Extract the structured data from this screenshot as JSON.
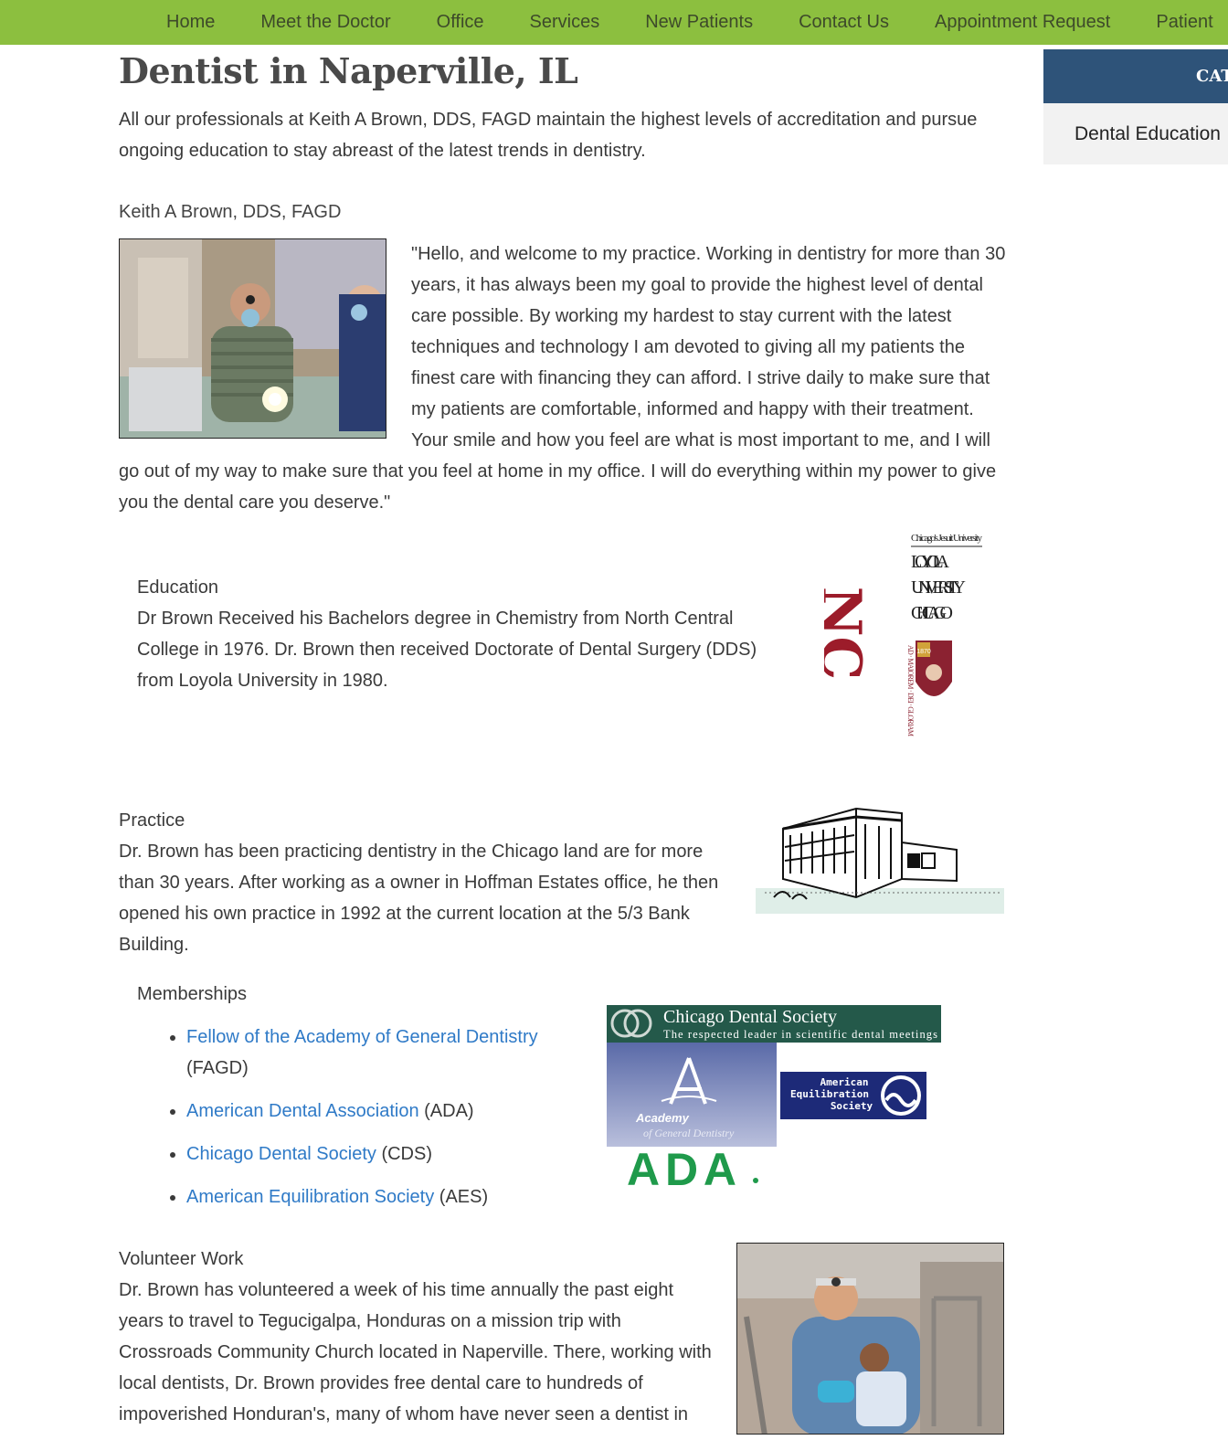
{
  "nav": {
    "items": [
      "Home",
      "Meet the Doctor",
      "Office",
      "Services",
      "New Patients",
      "Contact Us",
      "Appointment Request",
      "Patient"
    ]
  },
  "main": {
    "title": "Dentist in Naperville, IL",
    "intro": "All our professionals at Keith A Brown, DDS, FAGD maintain the highest levels of accreditation and pursue ongoing education to stay abreast of the latest trends in dentistry.",
    "doctor_name": "Keith A Brown, DDS, FAGD",
    "welcome": "\"Hello, and welcome to my practice. Working in dentistry for more than 30 years, it has always been my goal to provide the highest level of dental care possible. By working my hardest to stay current with the latest techniques and technology I am devoted to giving all my patients the finest care with financing they can afford. I strive daily to make sure that my patients are comfortable, informed and happy with their treatment. Your smile and how you feel are what is most important to me, and I will go out of my way to make sure that you feel at home in my office. I will do everything within my power to give you the dental care you deserve.\"",
    "education": {
      "heading": "Education",
      "text": "Dr Brown Received his Bachelors degree in Chemistry from North Central College in 1976. Dr. Brown then received Doctorate of Dental Surgery (DDS) from Loyola University in 1980.",
      "logo_nc": "NC",
      "loyola_top": "Chicago's Jesuit University",
      "loyola_lines": [
        "LOYOLA",
        "UNIVERSITY",
        "CHICAGO"
      ],
      "loyola_seal": "AD · MAIOREM · DEI · GLORIAM",
      "loyola_year": "1870"
    },
    "practice": {
      "heading": "Practice",
      "text": "Dr. Brown has been practicing dentistry in the Chicago land are for more than 30 years. After working as a owner in Hoffman Estates office, he then opened his own practice in 1992 at the current location at the 5/3 Bank Building."
    },
    "memberships": {
      "heading": "Memberships",
      "items": [
        {
          "link": "Fellow of the Academy of General Dentistry",
          "suffix": " (FAGD)"
        },
        {
          "link": "American Dental Association",
          "suffix": " (ADA)"
        },
        {
          "link": "Chicago Dental Society",
          "suffix": " (CDS)"
        },
        {
          "link": "American Equilibration Society",
          "suffix": " (AES)"
        }
      ],
      "cds_title": "Chicago Dental Society",
      "cds_sub": "The respected leader in scientific dental meetings",
      "agd_line1": "Academy",
      "agd_line2": "of General Dentistry",
      "aes_lines": [
        "American",
        "Equilibration",
        "Society"
      ],
      "ada": "ADA"
    },
    "volunteer": {
      "heading": "Volunteer Work",
      "text": "Dr. Brown has volunteered a week of his time annually the past eight years to travel to Tegucigalpa, Honduras on a mission trip with Crossroads Community Church located in Naperville. There, working with local dentists, Dr. Brown provides free dental care to hundreds of impoverished Honduran's, many of whom have never seen a dentist in"
    }
  },
  "sidebar": {
    "header": "CAT",
    "item": "Dental Education"
  },
  "colors": {
    "nav_bg": "#8cbf3f",
    "sidebar_header_bg": "#2e5379",
    "link": "#2f7ac7",
    "cds_green": "#24594a",
    "aes_navy": "#1d2a78",
    "ada_green": "#1f9a4b",
    "nc_red": "#9c1c2a",
    "loyola_maroon": "#8b2231"
  }
}
